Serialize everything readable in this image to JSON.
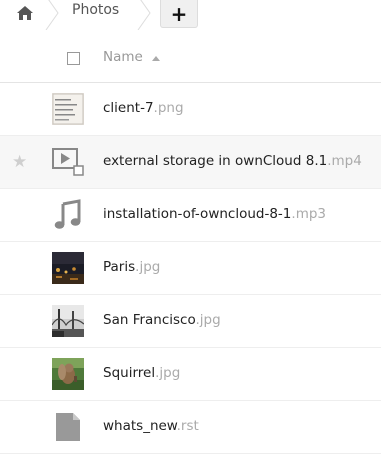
{
  "breadcrumb": {
    "home_icon": "home-icon",
    "current_folder": "Photos"
  },
  "toolbar": {
    "new_label": "+"
  },
  "header": {
    "name_column": "Name",
    "sort": "ascending"
  },
  "files": [
    {
      "base": "client-7",
      "ext": ".png",
      "icon": "image-thumbnail",
      "favorite": false
    },
    {
      "base": "external storage in ownCloud 8.1",
      "ext": ".mp4",
      "icon": "video-icon",
      "favorite": false
    },
    {
      "base": "installation-of-owncloud-8-1",
      "ext": ".mp3",
      "icon": "music-note-icon",
      "favorite": false
    },
    {
      "base": "Paris",
      "ext": ".jpg",
      "icon": "image-thumbnail",
      "favorite": false
    },
    {
      "base": "San Francisco",
      "ext": ".jpg",
      "icon": "image-thumbnail",
      "favorite": false
    },
    {
      "base": "Squirrel",
      "ext": ".jpg",
      "icon": "image-thumbnail",
      "favorite": false
    },
    {
      "base": "whats_new",
      "ext": ".rst",
      "icon": "file-icon",
      "favorite": false
    }
  ],
  "colors": {
    "extension": "#aaaaaa",
    "filename": "#222222",
    "hover_row": "#f7f7f7",
    "icon_gray": "#888888"
  }
}
